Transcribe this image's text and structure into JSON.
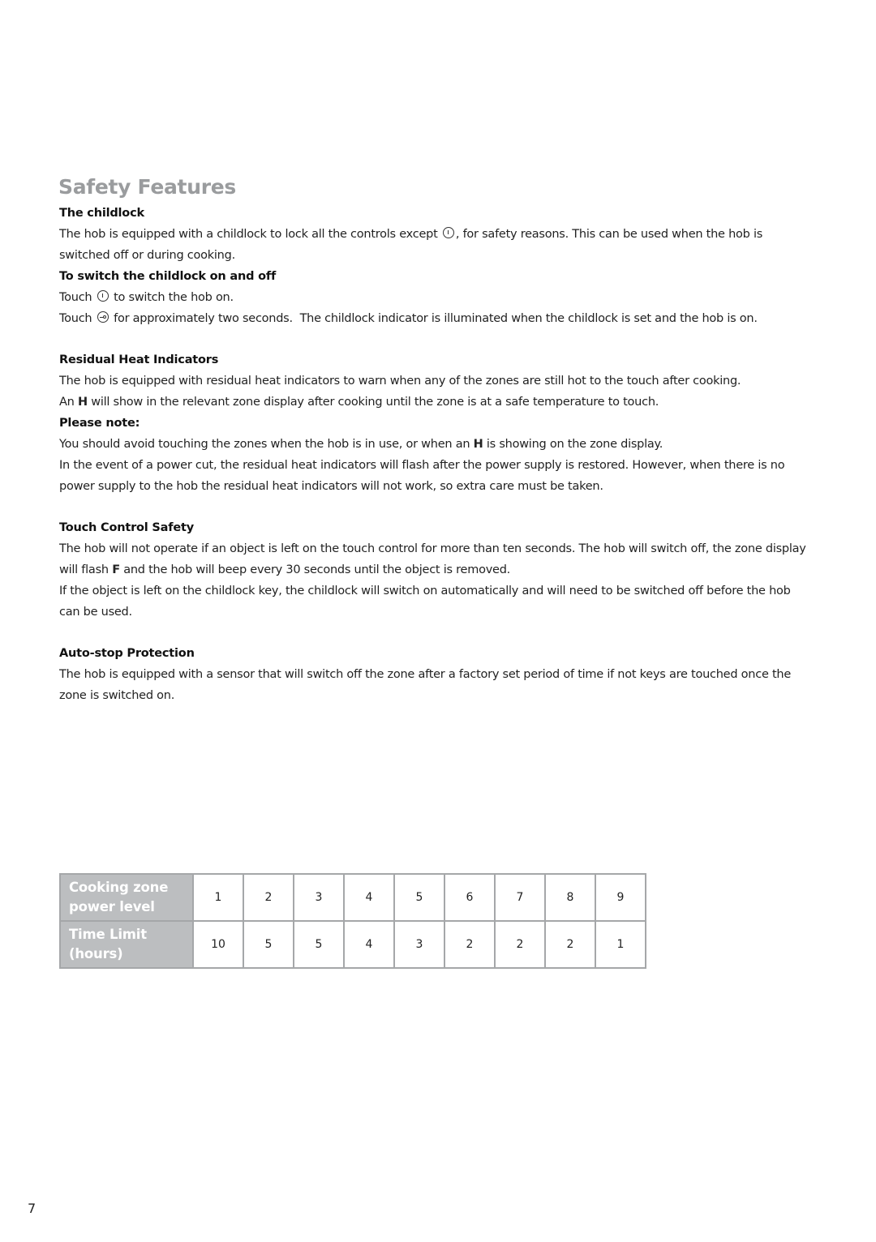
{
  "page_title": "Safety Features",
  "sections": {
    "childlock": {
      "heading": "The childlock",
      "p1_a": "The hob is equipped with a childlock to lock all the controls except ",
      "p1_b": ", for safety reasons. This can be used when the hob is switched off or during cooking.",
      "sub_heading": "To switch the childlock on and off",
      "step1_a": "Touch ",
      "step1_b": " to switch the hob on.",
      "step2_a": "Touch ",
      "step2_b": " for approximately two seconds.  The childlock indicator is illuminated when the childlock is set and the hob is on.",
      "icons": [
        "power-icon",
        "key-icon"
      ]
    },
    "residual_heat": {
      "heading": "Residual Heat Indicators",
      "p1": "The hob is equipped with residual heat indicators to warn when any of the zones are still hot to the touch after cooking.",
      "p2_a": "An ",
      "p2_bold": "H",
      "p2_b": " will show in the relevant zone display after cooking until the zone is at a safe temperature to touch.",
      "note_heading": "Please note:",
      "note1_a": "You should avoid touching the zones when the hob is in use, or when an ",
      "note1_bold": "H",
      "note1_b": " is showing on the zone display.",
      "note2": "In the event of a power cut, the residual heat indicators will flash after the power supply is restored. However, when there is no power supply to the hob the residual heat indicators will not work, so extra care must be taken."
    },
    "touch_control": {
      "heading": "Touch Control Safety",
      "p1_a": "The hob will not operate if an object is left on the touch control for more than ten seconds. The hob will switch off, the zone display will flash ",
      "p1_bold": "F",
      "p1_b": " and the hob will beep every 30 seconds until the object is removed.",
      "p2": "If the object is left on the childlock key, the childlock will switch on automatically and will need to be switched off before the hob can be used."
    },
    "auto_stop": {
      "heading": "Auto-stop Protection",
      "p1": "The hob is equipped with a sensor that will switch off the zone after a factory set period of time if not keys are touched once the zone is switched on."
    }
  },
  "table": {
    "row_headers": [
      "Cooking zone power level",
      "Time Limit (hours)"
    ],
    "power_levels": [
      "1",
      "2",
      "3",
      "4",
      "5",
      "6",
      "7",
      "8",
      "9"
    ],
    "time_limits": [
      "10",
      "5",
      "5",
      "4",
      "3",
      "2",
      "2",
      "2",
      "1"
    ],
    "header_color": "#bcbec0",
    "border_color": "#a5a7a9"
  },
  "page_number": "7",
  "colors": {
    "title": "#9a9c9e"
  }
}
